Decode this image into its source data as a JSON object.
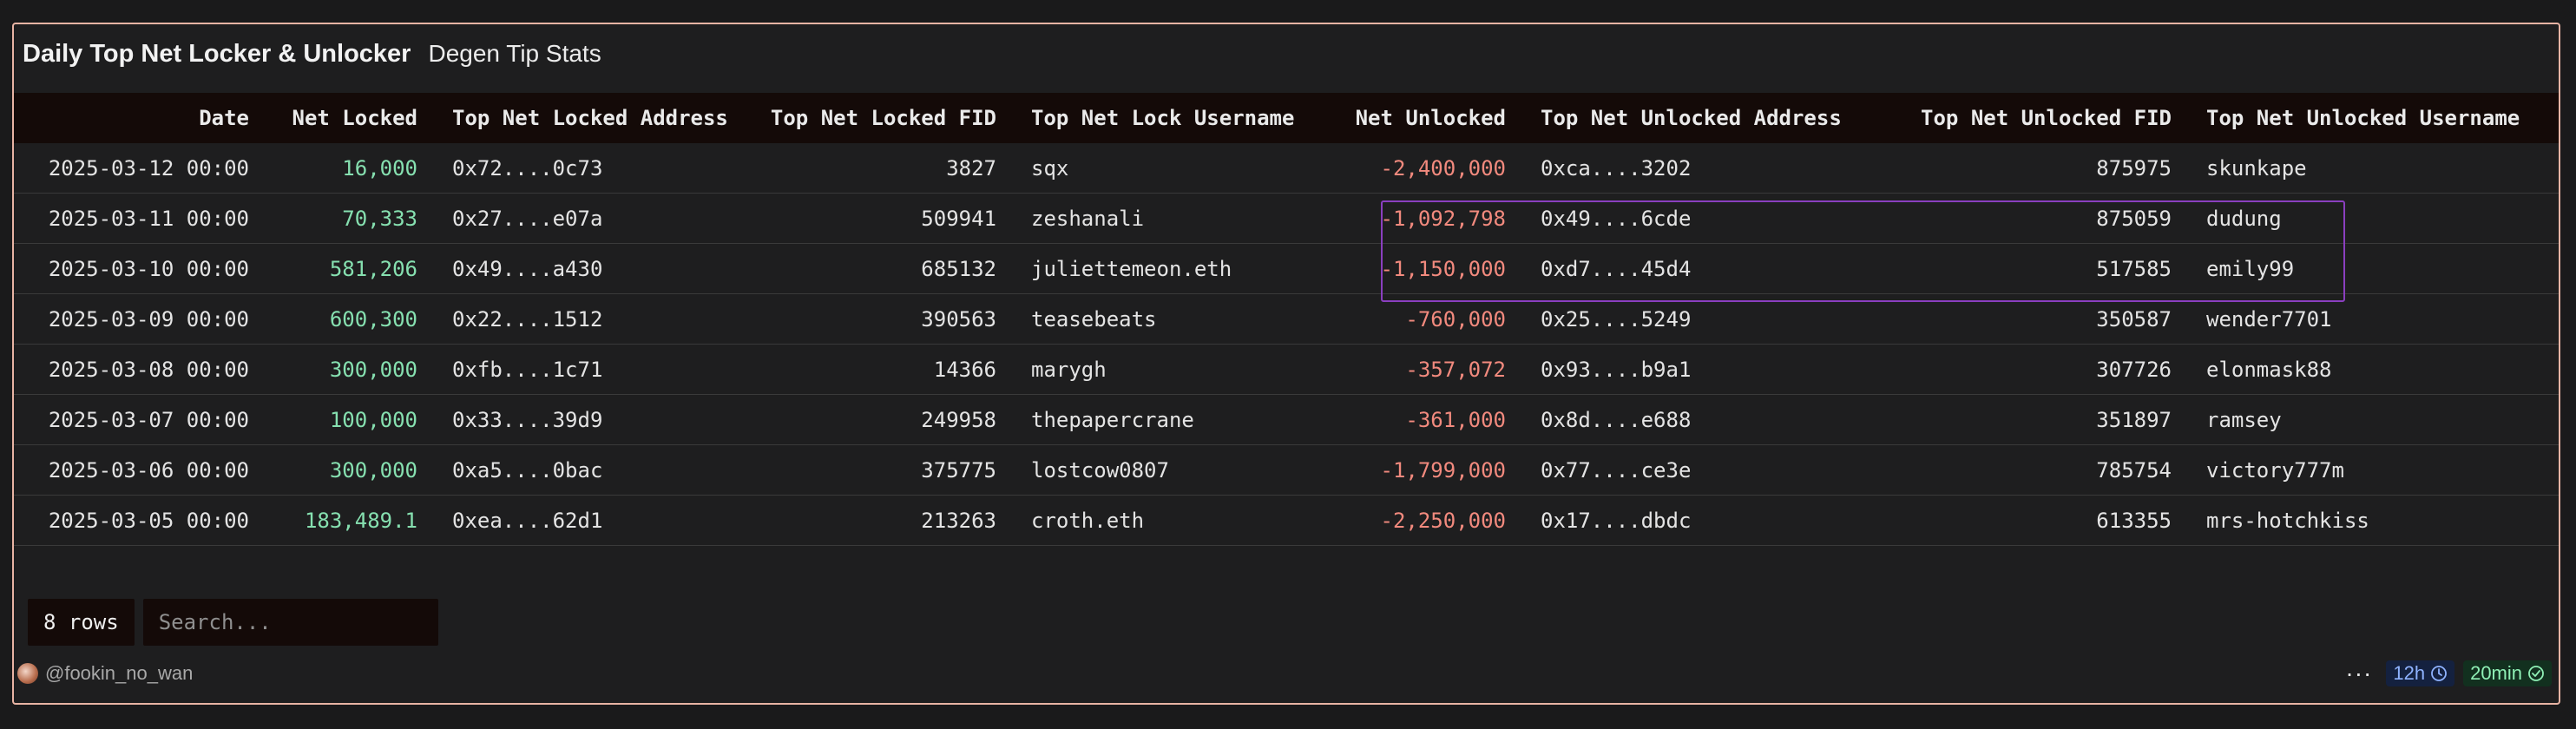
{
  "header": {
    "title": "Daily Top Net Locker & Unlocker",
    "subtitle": "Degen Tip Stats"
  },
  "table": {
    "columns": [
      "Date",
      "Net Locked",
      "Top Net Locked Address",
      "Top Net Locked FID",
      "Top Net Lock Username",
      "Net Unlocked",
      "Top Net Unlocked Address",
      "Top Net Unlocked FID",
      "Top Net Unlocked Username"
    ],
    "rows": [
      [
        "2025-03-12 00:00",
        "16,000",
        "0x72....0c73",
        "3827",
        "sqx",
        "-2,400,000",
        "0xca....3202",
        "875975",
        "skunkape"
      ],
      [
        "2025-03-11 00:00",
        "70,333",
        "0x27....e07a",
        "509941",
        "zeshanali",
        "-1,092,798",
        "0x49....6cde",
        "875059",
        "dudung"
      ],
      [
        "2025-03-10 00:00",
        "581,206",
        "0x49....a430",
        "685132",
        "juliettemeon.eth",
        "-1,150,000",
        "0xd7....45d4",
        "517585",
        "emily99"
      ],
      [
        "2025-03-09 00:00",
        "600,300",
        "0x22....1512",
        "390563",
        "teasebeats",
        "-760,000",
        "0x25....5249",
        "350587",
        "wender7701"
      ],
      [
        "2025-03-08 00:00",
        "300,000",
        "0xfb....1c71",
        "14366",
        "marygh",
        "-357,072",
        "0x93....b9a1",
        "307726",
        "elonmask88"
      ],
      [
        "2025-03-07 00:00",
        "100,000",
        "0x33....39d9",
        "249958",
        "thepapercrane",
        "-361,000",
        "0x8d....e688",
        "351897",
        "ramsey"
      ],
      [
        "2025-03-06 00:00",
        "300,000",
        "0xa5....0bac",
        "375775",
        "lostcow0807",
        "-1,799,000",
        "0x77....ce3e",
        "785754",
        "victory777m"
      ],
      [
        "2025-03-05 00:00",
        "183,489.1",
        "0xea....62d1",
        "213263",
        "croth.eth",
        "-2,250,000",
        "0x17....dbdc",
        "613355",
        "mrs-hotchkiss"
      ]
    ]
  },
  "controls": {
    "rows_label": "8 rows",
    "search_placeholder": "Search..."
  },
  "footer": {
    "author": "@fookin_no_wan",
    "more_label": "···",
    "refresh_interval": "12h",
    "cache_age": "20min"
  },
  "colors": {
    "positive": "#86e0b0",
    "negative": "#f28a7e",
    "border": "#e8b4a4",
    "highlight": "#8a3fbf"
  }
}
